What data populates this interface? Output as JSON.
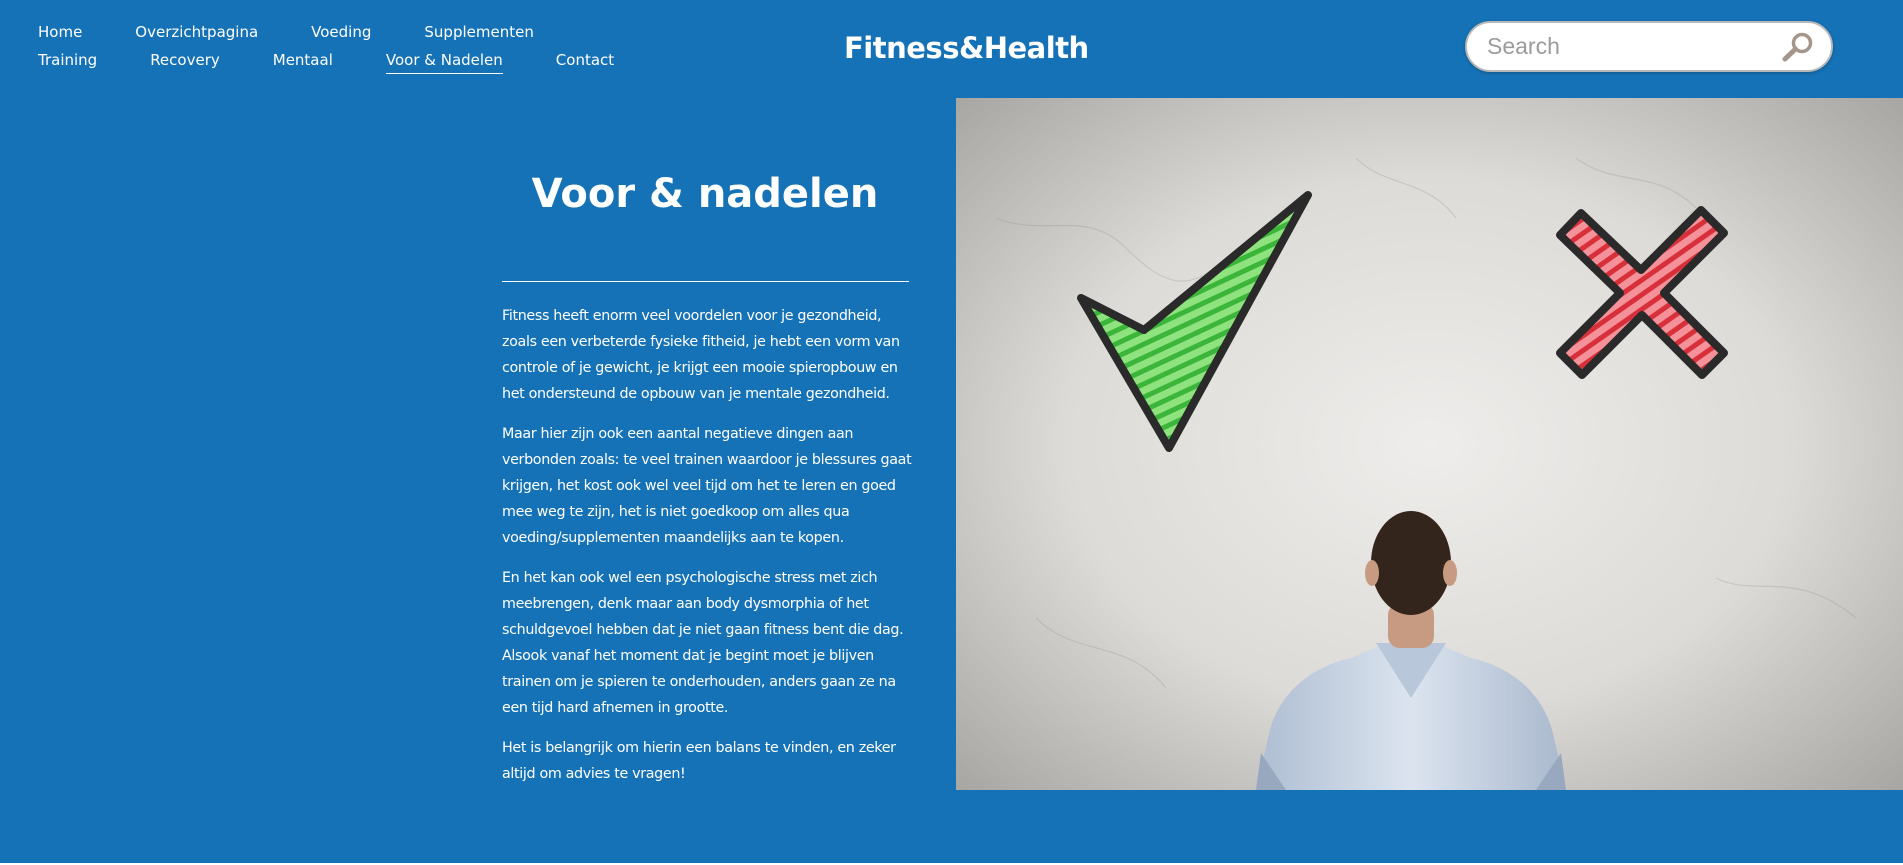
{
  "nav": {
    "row1": [
      "Home",
      "Overzichtpagina",
      "Voeding",
      "Supplementen"
    ],
    "row2": [
      "Training",
      "Recovery",
      "Mentaal",
      "Voor & Nadelen",
      "Contact"
    ],
    "active": "Voor & Nadelen"
  },
  "brand": "Fitness&Health",
  "search": {
    "placeholder": "Search",
    "value": "",
    "icon": "magnifier-icon"
  },
  "content": {
    "title": "Voor & nadelen",
    "paragraphs": [
      "Fitness heeft enorm veel voordelen voor je gezondheid, zoals een verbeterde fysieke fitheid, je hebt een vorm van controle of je gewicht, je krijgt een mooie spieropbouw en het ondersteund de opbouw van je mentale gezondheid.",
      "Maar hier zijn ook een aantal negatieve dingen aan verbonden zoals: te veel trainen waardoor je blessures gaat krijgen, het kost ook wel veel tijd om het te leren en goed mee weg te zijn, het is niet goedkoop om alles qua voeding/supplementen maandelijks aan te kopen.",
      "En het kan ook wel een psychologische stress met zich meebrengen, denk maar aan body dysmorphia of het schuldgevoel hebben dat je niet gaan fitness bent die dag. Alsook vanaf het moment dat je begint moet je blijven trainen om je spieren te onderhouden, anders gaan ze na een tijd hard afnemen in grootte.",
      "Het is belangrijk om hierin een balans te vinden, en zeker altijd om advies te vragen!"
    ]
  },
  "hero_image": {
    "icons": [
      "checkmark-icon",
      "cross-icon"
    ],
    "colors": {
      "check": "#5ccf4e",
      "cross": "#e3424c",
      "wall": "#d8d6d2",
      "shirt": "#c9d6e6"
    }
  },
  "colors": {
    "background": "#1572b6",
    "text": "#ffffff"
  }
}
